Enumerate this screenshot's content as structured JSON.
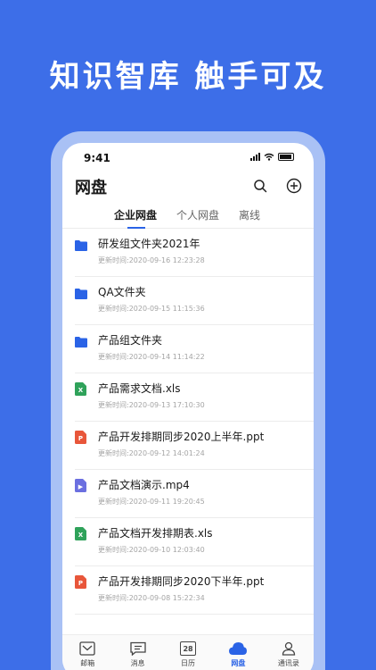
{
  "headline": "知识智库 触手可及",
  "status": {
    "time": "9:41"
  },
  "app": {
    "title": "网盘"
  },
  "tabs": [
    {
      "label": "企业网盘",
      "active": true
    },
    {
      "label": "个人网盘",
      "active": false
    },
    {
      "label": "离线",
      "active": false
    }
  ],
  "meta_prefix": "更新时间:",
  "files": [
    {
      "name": "研发组文件夹2021年",
      "updated": "2020-09-16 12:23:28",
      "icon": "folder-icon",
      "color": "#2a63e6"
    },
    {
      "name": "QA文件夹",
      "updated": "2020-09-15 11:15:36",
      "icon": "folder-icon",
      "color": "#2a63e6"
    },
    {
      "name": "产品组文件夹",
      "updated": "2020-09-14 11:14:22",
      "icon": "folder-icon",
      "color": "#2a63e6"
    },
    {
      "name": "产品需求文档.xls",
      "updated": "2020-09-13 17:10:30",
      "icon": "excel-file-icon",
      "color": "#2fa25a",
      "glyph": "X"
    },
    {
      "name": "产品开发排期同步2020上半年.ppt",
      "updated": "2020-09-12 14:01:24",
      "icon": "ppt-file-icon",
      "color": "#e8563a",
      "glyph": "P"
    },
    {
      "name": "产品文档演示.mp4",
      "updated": "2020-09-11 19:20:45",
      "icon": "video-file-icon",
      "color": "#6b6fe0",
      "glyph": "▶"
    },
    {
      "name": "产品文档开发排期表.xls",
      "updated": "2020-09-10 12:03:40",
      "icon": "excel-file-icon",
      "color": "#2fa25a",
      "glyph": "X"
    },
    {
      "name": "产品开发排期同步2020下半年.ppt",
      "updated": "2020-09-08 15:22:34",
      "icon": "ppt-file-icon",
      "color": "#e8563a",
      "glyph": "P"
    }
  ],
  "tabbar": [
    {
      "label": "邮箱",
      "icon": "mail-icon",
      "active": false
    },
    {
      "label": "消息",
      "icon": "message-icon",
      "active": false
    },
    {
      "label": "日历",
      "icon": "calendar-icon",
      "active": false,
      "badge": "28"
    },
    {
      "label": "网盘",
      "icon": "cloud-icon",
      "active": true
    },
    {
      "label": "通讯录",
      "icon": "contacts-icon",
      "active": false
    }
  ],
  "colors": {
    "background": "#3d6ee8",
    "accent": "#2a63e6"
  }
}
